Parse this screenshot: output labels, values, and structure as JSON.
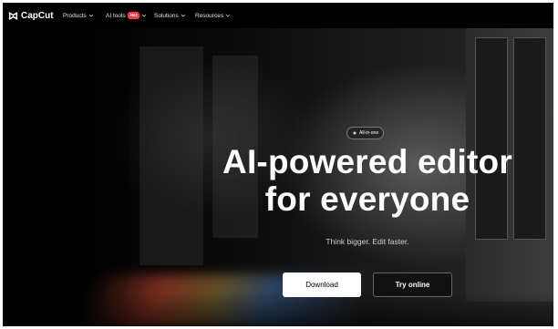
{
  "brand": {
    "name": "CapCut"
  },
  "nav": {
    "items": [
      {
        "label": "Products"
      },
      {
        "label": "AI tools",
        "badge": "Hot"
      },
      {
        "label": "Solutions"
      },
      {
        "label": "Resources"
      }
    ]
  },
  "hero": {
    "pill_label": "All-in-one",
    "headline_line1": "AI-powered editor",
    "headline_line2": "for everyone",
    "subhead": "Think bigger. Edit faster.",
    "download_label": "Download",
    "try_label": "Try online"
  },
  "colors": {
    "badge": "#ff3b4a",
    "background": "#000000",
    "primary_button": "#ffffff"
  }
}
